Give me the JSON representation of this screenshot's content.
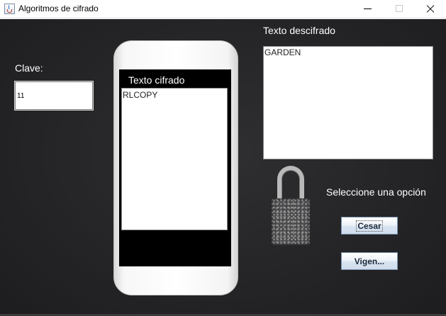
{
  "window": {
    "title": "Algoritmos de cifrado"
  },
  "form": {
    "clave_label": "Clave:",
    "clave_value": "11",
    "cifrado_label": "Texto cifrado",
    "cifrado_text": "RLCOPY",
    "descifrado_label": "Texto descifrado",
    "descifrado_text": "GARDEN",
    "opcion_label": "Seleccione una opción",
    "cesar_button": "Cesar",
    "vigenere_button": "Vigen..."
  },
  "icons": {
    "app": "java-cup-icon",
    "minimize": "minimize-icon",
    "maximize": "maximize-icon",
    "close": "close-icon",
    "lock": "padlock-image",
    "phone": "smartphone-image"
  },
  "colors": {
    "background": "#252527",
    "label_text": "#ffffff",
    "button_border": "#7f97b4"
  }
}
